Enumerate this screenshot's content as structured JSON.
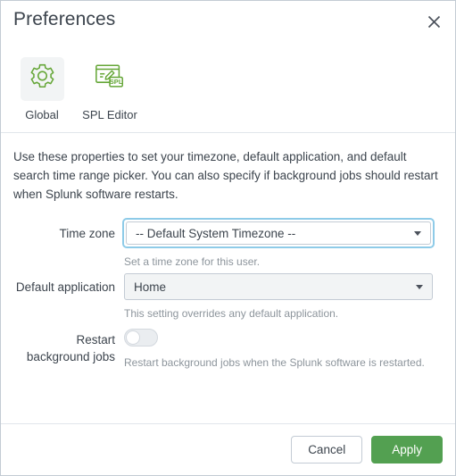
{
  "dialog": {
    "title": "Preferences",
    "close_icon": "close-icon"
  },
  "tabs": [
    {
      "label": "Global",
      "icon": "gear-icon",
      "selected": true
    },
    {
      "label": "SPL Editor",
      "icon": "spl-editor-icon",
      "selected": false
    }
  ],
  "description": "Use these properties to set your timezone, default application, and default search time range picker. You can also specify if background jobs should restart when Splunk software restarts.",
  "fields": {
    "timezone": {
      "label": "Time zone",
      "value": "-- Default System Timezone --",
      "help": "Set a time zone for this user.",
      "focused": true
    },
    "default_application": {
      "label": "Default application",
      "value": "Home",
      "help": "This setting overrides any default application.",
      "focused": false
    },
    "restart_background_jobs": {
      "label_line1": "Restart",
      "label_line2": "background jobs",
      "help": "Restart background jobs when the Splunk software is restarted.",
      "state": "off"
    }
  },
  "footer": {
    "cancel_label": "Cancel",
    "apply_label": "Apply"
  },
  "colors": {
    "accent_green": "#53a051",
    "focus_blue": "#8ecbe8",
    "text": "#3c444d",
    "muted_text": "#8d959c",
    "border": "#c3cbd4"
  }
}
